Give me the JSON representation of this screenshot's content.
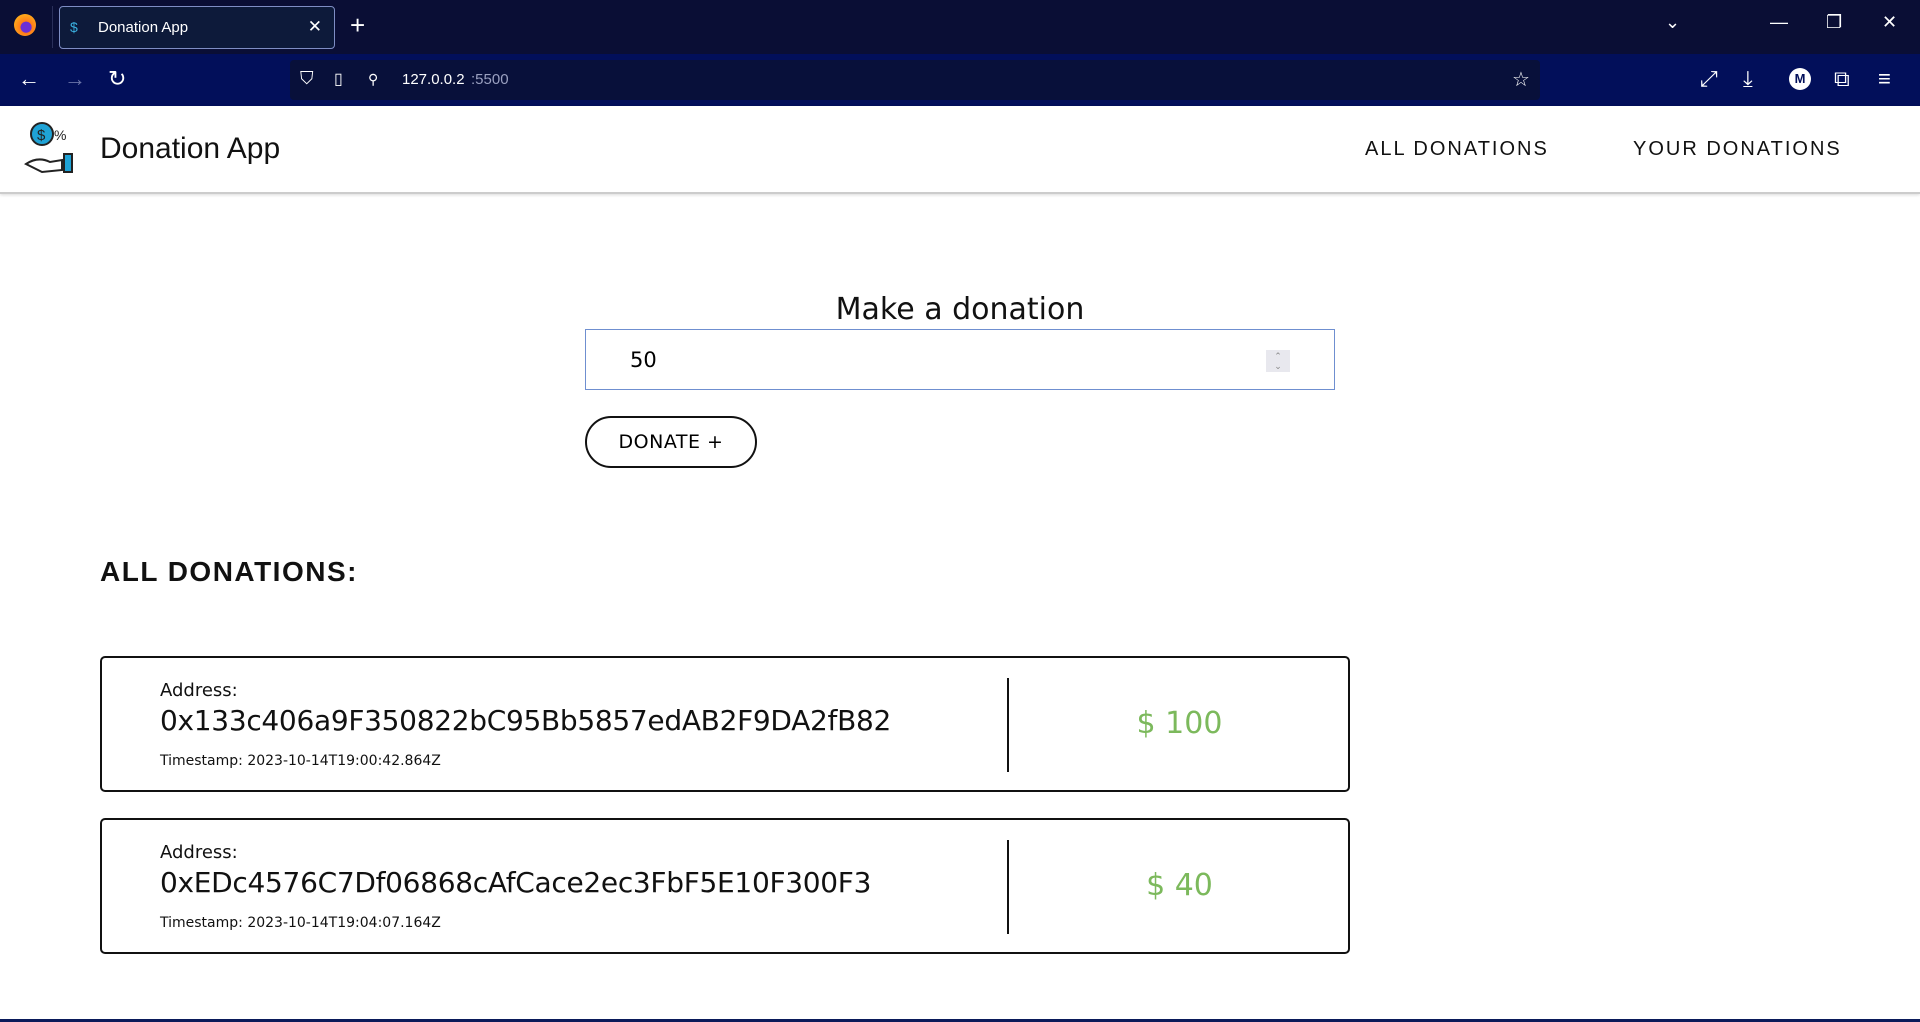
{
  "browser": {
    "tab_title": "Donation App",
    "url_host": "127.0.0.2",
    "url_port": ":5500",
    "profile_initial": "M"
  },
  "header": {
    "title": "Donation App",
    "nav": [
      {
        "label": "ALL DONATIONS"
      },
      {
        "label": "YOUR DONATIONS"
      }
    ]
  },
  "form": {
    "title": "Make a donation",
    "amount_value": "50",
    "donate_label": "DONATE +"
  },
  "donations": {
    "title": "ALL DONATIONS:",
    "address_label": "Address:",
    "items": [
      {
        "address": "0x133c406a9F350822bC95Bb5857edAB2F9DA2fB82",
        "timestamp": "Timestamp: 2023-10-14T19:00:42.864Z",
        "amount": "$ 100"
      },
      {
        "address": "0xEDc4576C7Df06868cAfCace2ec3FbF5E10F300F3",
        "timestamp": "Timestamp: 2023-10-14T19:04:07.164Z",
        "amount": "$ 40"
      }
    ]
  },
  "colors": {
    "amount": "#7cb95c",
    "tabbar": "#0a0e35",
    "navbar": "#020f5a"
  }
}
